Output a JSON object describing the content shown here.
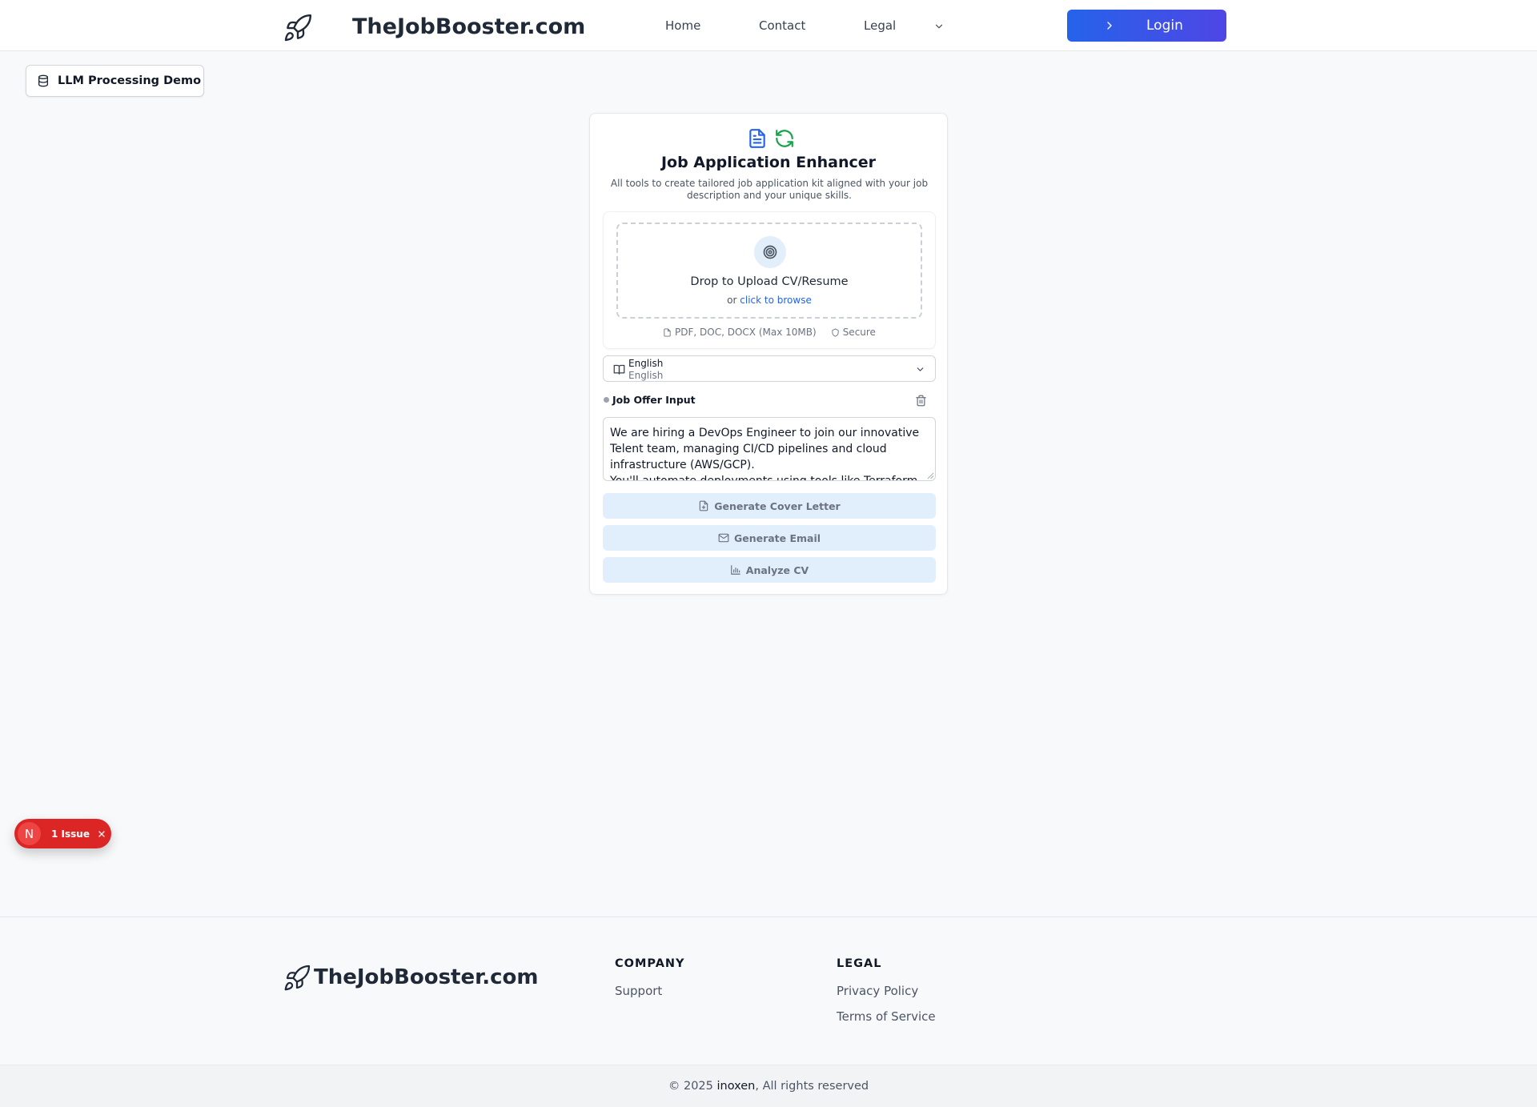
{
  "header": {
    "brand": "TheJobBooster.com",
    "nav": {
      "home": "Home",
      "contact": "Contact",
      "legal": "Legal"
    },
    "login_label": "Login"
  },
  "demo_badge": {
    "label": "LLM Processing Demo"
  },
  "card": {
    "title": "Job Application Enhancer",
    "subtitle": "All tools to create tailored job application kit aligned with your job description and your unique skills.",
    "upload": {
      "title": "Drop to Upload CV/Resume",
      "or_text": "or",
      "browse_link": "click to browse",
      "formats": "PDF, DOC, DOCX (Max 10MB)",
      "secure": "Secure"
    },
    "language": {
      "selected": "English",
      "secondary": "English"
    },
    "job_offer": {
      "label": "Job Offer Input",
      "value": "We are hiring a DevOps Engineer to join our innovative Telent team, managing CI/CD pipelines and cloud infrastructure (AWS/GCP).\nYou'll automate deployments using tools like Terraform"
    },
    "actions": {
      "cover_letter": "Generate Cover Letter",
      "email": "Generate Email",
      "analyze": "Analyze CV"
    }
  },
  "issue_badge": {
    "n": "N",
    "label": "1 Issue"
  },
  "footer": {
    "brand": "TheJobBooster.com",
    "company_heading": "COMPANY",
    "support": "Support",
    "legal_heading": "LEGAL",
    "privacy": "Privacy Policy",
    "terms": "Terms of Service",
    "copyright_prefix": "© 2025",
    "company_name": "inoxen",
    "copyright_suffix": ", All rights reserved"
  },
  "colors": {
    "accent": "#2563eb",
    "accent_end": "#4f46e5",
    "action_bg": "#e1effc",
    "issue_red": "#dc2626",
    "refresh_green": "#16a34a"
  },
  "icons": [
    "rocket-icon",
    "chevron-down-icon",
    "chevron-right-icon",
    "database-icon",
    "document-icon",
    "refresh-icon",
    "target-icon",
    "file-icon",
    "shield-icon",
    "book-open-icon",
    "trash-icon",
    "file-plus-icon",
    "mail-icon",
    "bar-chart-icon",
    "close-icon"
  ]
}
